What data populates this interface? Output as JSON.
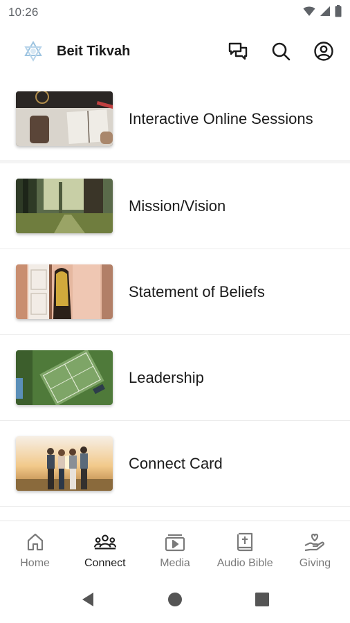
{
  "status_bar": {
    "time": "10:26",
    "icons": [
      "wifi-icon",
      "signal-icon",
      "battery-icon"
    ]
  },
  "header": {
    "title": "Beit Tikvah",
    "logo_icon": "star-of-david-logo",
    "actions": [
      "chat-icon",
      "search-icon",
      "account-icon"
    ]
  },
  "list": {
    "items": [
      {
        "label": "Interactive Online Sessions",
        "thumbnail": "open-bible-on-table"
      },
      {
        "label": "Mission/Vision",
        "thumbnail": "forest-path"
      },
      {
        "label": "Statement of Beliefs",
        "thumbnail": "doorway-figure"
      },
      {
        "label": "Leadership",
        "thumbnail": "aerial-tennis-court"
      },
      {
        "label": "Connect Card",
        "thumbnail": "friends-sunset"
      }
    ]
  },
  "bottom_nav": {
    "active": "Connect",
    "tabs": [
      {
        "label": "Home",
        "icon": "home-icon"
      },
      {
        "label": "Connect",
        "icon": "people-icon"
      },
      {
        "label": "Media",
        "icon": "media-icon"
      },
      {
        "label": "Audio Bible",
        "icon": "bible-icon"
      },
      {
        "label": "Giving",
        "icon": "giving-hand-icon"
      }
    ]
  },
  "system_nav": [
    "back-icon",
    "home-circle-icon",
    "recents-icon"
  ],
  "colors": {
    "text_primary": "#1b1b1b",
    "text_secondary": "#7a7a7a",
    "status_gray": "#5f6368",
    "divider": "#ececec"
  }
}
